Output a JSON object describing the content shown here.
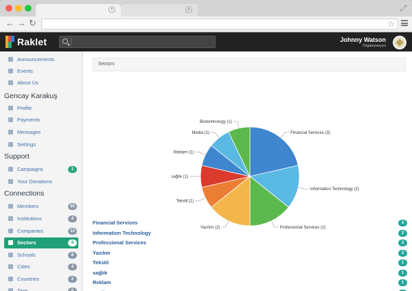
{
  "app": {
    "brand": "Raklet",
    "user_name": "Johnny Watson",
    "user_role": "Organizasyon"
  },
  "sidebar": {
    "top_items": [
      {
        "label": "Announcements",
        "icon": "megaphone-icon"
      },
      {
        "label": "Events",
        "icon": "calendar-icon"
      },
      {
        "label": "About Us",
        "icon": "info-icon"
      }
    ],
    "sections": [
      {
        "heading": "Gencay Karakuş",
        "items": [
          {
            "label": "Profile",
            "icon": "user-icon"
          },
          {
            "label": "Payments",
            "icon": "credit-card-icon"
          },
          {
            "label": "Messages",
            "icon": "envelope-icon"
          },
          {
            "label": "Settings",
            "icon": "gear-icon"
          }
        ]
      },
      {
        "heading": "Support",
        "items": [
          {
            "label": "Campaigns",
            "icon": "flag-icon",
            "badge": "1"
          },
          {
            "label": "Your Donations",
            "icon": "heart-icon"
          }
        ]
      },
      {
        "heading": "Connections",
        "items": [
          {
            "label": "Members",
            "icon": "users-icon",
            "badge": "55"
          },
          {
            "label": "Institutions",
            "icon": "building-icon",
            "badge": "4"
          },
          {
            "label": "Companies",
            "icon": "briefcase-icon",
            "badge": "13"
          },
          {
            "label": "Sectors",
            "icon": "tag-icon",
            "badge": "9"
          },
          {
            "label": "Schools",
            "icon": "graduation-icon",
            "badge": "8"
          },
          {
            "label": "Cities",
            "icon": "pin-icon",
            "badge": "4"
          },
          {
            "label": "Countries",
            "icon": "globe-icon",
            "badge": "2"
          },
          {
            "label": "Tags",
            "icon": "tag-icon",
            "badge": "6"
          }
        ]
      }
    ]
  },
  "main": {
    "panel_title": "Sectors",
    "list": [
      {
        "label": "Financial Services",
        "count": "3"
      },
      {
        "label": "Information Technology",
        "count": "2"
      },
      {
        "label": "Professional Services",
        "count": "2"
      },
      {
        "label": "Yazılım",
        "count": "2"
      },
      {
        "label": "Tekstil",
        "count": "1"
      },
      {
        "label": "sağlık",
        "count": "1"
      },
      {
        "label": "Reklam",
        "count": "1"
      },
      {
        "label": "Media",
        "count": "1"
      }
    ]
  },
  "chart_data": {
    "type": "pie",
    "title": "",
    "slices": [
      {
        "label": "Financial Services (3)",
        "value": 3,
        "color": "#3f86cf"
      },
      {
        "label": "Information Technology (2)",
        "value": 2,
        "color": "#5ab9e2"
      },
      {
        "label": "Professional Services (2)",
        "value": 2,
        "color": "#5bb84c"
      },
      {
        "label": "Yazılım (2)",
        "value": 2,
        "color": "#f2b64a"
      },
      {
        "label": "Tekstil (1)",
        "value": 1,
        "color": "#ec7d35"
      },
      {
        "label": "sağlık (1)",
        "value": 1,
        "color": "#da3b2c"
      },
      {
        "label": "Reklam (1)",
        "value": 1,
        "color": "#3f86cf"
      },
      {
        "label": "Media (1)",
        "value": 1,
        "color": "#5ab9e2"
      },
      {
        "label": "Biotechnology (1)",
        "value": 1,
        "color": "#5bb84c"
      }
    ]
  }
}
